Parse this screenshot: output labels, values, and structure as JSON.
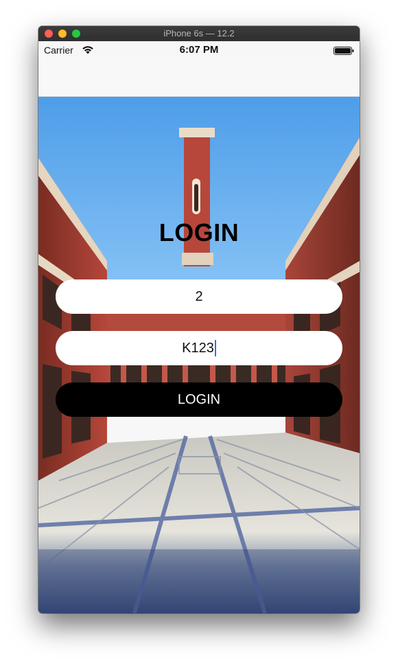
{
  "window": {
    "title": "iPhone 6s — 12.2"
  },
  "status_bar": {
    "carrier": "Carrier",
    "time": "6:07 PM",
    "wifi_icon": "wifi-icon",
    "battery_icon": "battery-icon"
  },
  "login": {
    "title": "LOGIN",
    "username_value": "2",
    "password_value": "K123",
    "button_label": "LOGIN"
  },
  "colors": {
    "button_bg": "#000000",
    "field_bg": "#ffffff",
    "caret": "#2f6df6",
    "sky": "#5aa8ef"
  }
}
